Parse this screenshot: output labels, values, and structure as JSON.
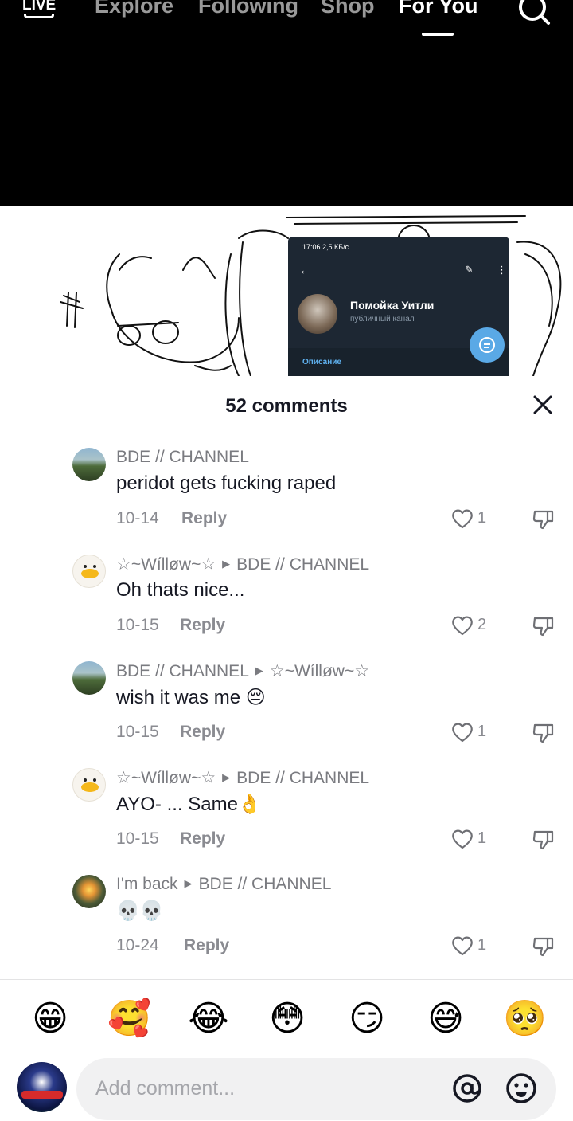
{
  "topnav": {
    "live_label": "LIVE",
    "tabs": [
      {
        "label": "Explore",
        "active": false
      },
      {
        "label": "Following",
        "active": false
      },
      {
        "label": "Shop",
        "active": false
      },
      {
        "label": "For You",
        "active": true
      }
    ]
  },
  "preview": {
    "status": "17:06  2,5 КБ/с",
    "channel_title": "Помойка Уитли",
    "channel_sub": "публичный канал",
    "description_label": "Описание"
  },
  "comments_sheet": {
    "title": "52 comments",
    "reply_label": "Reply",
    "comments": [
      {
        "user": "BDE // CHANNEL",
        "reply_to": "",
        "text": "peridot gets fucking raped",
        "date": "10-14",
        "likes": "1",
        "avatar": "forest"
      },
      {
        "user": "☆~Wílløw~☆",
        "reply_to": "BDE // CHANNEL",
        "text": "Oh thats nice...",
        "date": "10-15",
        "likes": "2",
        "avatar": "duck"
      },
      {
        "user": "BDE // CHANNEL",
        "reply_to": "☆~Wílløw~☆",
        "text": "wish it was me 😔",
        "date": "10-15",
        "likes": "1",
        "avatar": "forest"
      },
      {
        "user": "☆~Wílløw~☆",
        "reply_to": "BDE // CHANNEL",
        "text": "AYO- ... Same👌",
        "date": "10-15",
        "likes": "1",
        "avatar": "duck"
      },
      {
        "user": "I'm back",
        "reply_to": "BDE // CHANNEL",
        "text": "💀💀",
        "date": "10-24",
        "likes": "1",
        "avatar": "sunset"
      }
    ]
  },
  "emoji_bar": [
    "😁",
    "🥰",
    "😂",
    "😳",
    "😏",
    "😅",
    "🥺"
  ],
  "composer": {
    "placeholder": "Add comment..."
  },
  "colors": {
    "text_primary": "#161823",
    "text_secondary": "#8a8b91",
    "input_bg": "#f1f1f2"
  }
}
